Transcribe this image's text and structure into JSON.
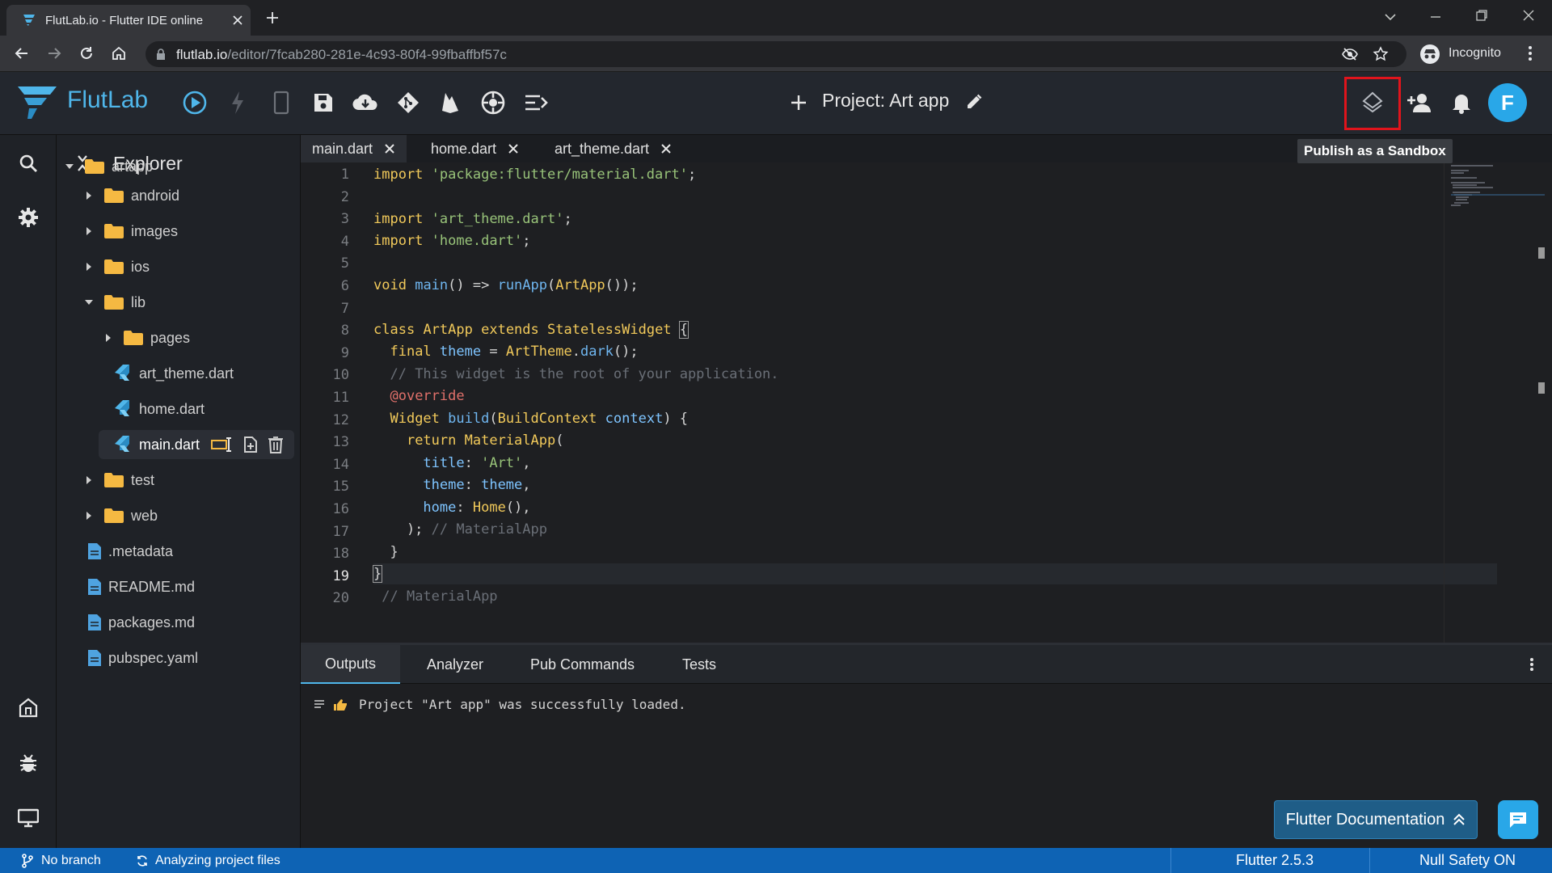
{
  "browser": {
    "tab_title": "FlutLab.io - Flutter IDE online",
    "url_host": "flutlab.io",
    "url_path": "/editor/7fcab280-281e-4c93-80f4-99fbaffbf57c",
    "profile_label": "Incognito"
  },
  "app": {
    "brand": "FlutLab",
    "project_title": "Project: Art app",
    "avatar_letter": "F",
    "tooltip": "Publish as a Sandbox"
  },
  "explorer": {
    "title": "Explorer",
    "items": [
      {
        "label": "artapp",
        "icon": "folder-icon"
      },
      {
        "label": "android",
        "icon": "folder-icon"
      },
      {
        "label": "images",
        "icon": "folder-icon"
      },
      {
        "label": "ios",
        "icon": "folder-icon"
      },
      {
        "label": "lib",
        "icon": "folder-icon"
      },
      {
        "label": "pages",
        "icon": "folder-icon"
      },
      {
        "label": "art_theme.dart",
        "icon": "dart-file-icon"
      },
      {
        "label": "home.dart",
        "icon": "dart-file-icon"
      },
      {
        "label": "main.dart",
        "icon": "dart-file-icon"
      },
      {
        "label": "test",
        "icon": "folder-icon"
      },
      {
        "label": "web",
        "icon": "folder-icon"
      },
      {
        "label": ".metadata",
        "icon": "file-icon"
      },
      {
        "label": "README.md",
        "icon": "file-icon"
      },
      {
        "label": "packages.md",
        "icon": "file-icon"
      },
      {
        "label": "pubspec.yaml",
        "icon": "file-icon"
      }
    ]
  },
  "editor": {
    "tabs": [
      {
        "label": "main.dart"
      },
      {
        "label": "home.dart"
      },
      {
        "label": "art_theme.dart"
      }
    ],
    "line_numbers": [
      "1",
      "2",
      "3",
      "4",
      "5",
      "6",
      "7",
      "8",
      "9",
      "10",
      "11",
      "12",
      "13",
      "14",
      "15",
      "16",
      "17",
      "18",
      "19",
      "20"
    ]
  },
  "panel": {
    "tabs": [
      "Outputs",
      "Analyzer",
      "Pub Commands",
      "Tests"
    ],
    "output_message": "Project \"Art app\" was successfully loaded.",
    "doc_button": "Flutter Documentation"
  },
  "status": {
    "branch": "No branch",
    "analyzing": "Analyzing project files",
    "flutter_version": "Flutter 2.5.3",
    "null_safety": "Null Safety ON"
  },
  "colors": {
    "accent": "#29a7e8",
    "brand": "#4fb6ea",
    "statusbar": "#0e63b4",
    "highlight": "#e0141c",
    "folder": "#f5b942"
  }
}
